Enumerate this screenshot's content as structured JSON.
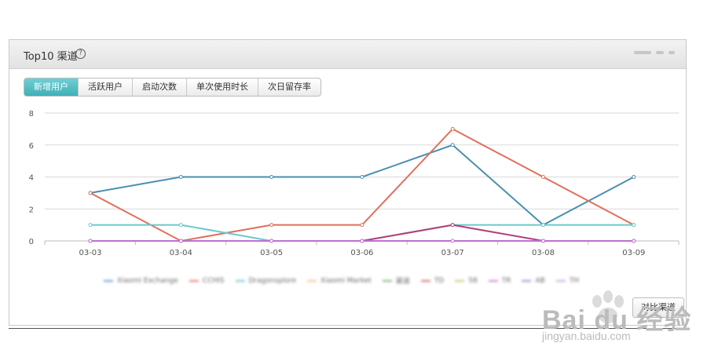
{
  "panel": {
    "title": "Top10 渠道",
    "help": "?",
    "tabs": [
      "新增用户",
      "活跃用户",
      "启动次数",
      "单次使用时长",
      "次日留存率"
    ],
    "active_tab": 0,
    "compare_button": "对比渠道"
  },
  "legend_items": [
    {
      "name": "Xiaomi Exchange",
      "color": "#5b9bd5"
    },
    {
      "name": "CCHIS",
      "color": "#e07a5f"
    },
    {
      "name": "Dragonsplore",
      "color": "#6cc9cc"
    },
    {
      "name": "Xiaomi Market",
      "color": "#f2c28b"
    },
    {
      "name": "渠道",
      "color": "#7bb07b"
    },
    {
      "name": "TD",
      "color": "#d06a6a"
    },
    {
      "name": "58",
      "color": "#c9c46a"
    },
    {
      "name": "TR",
      "color": "#d37bc6"
    },
    {
      "name": "AB",
      "color": "#9c88d4"
    },
    {
      "name": "TH",
      "color": "#c9a6d9"
    }
  ],
  "chart_data": {
    "type": "line",
    "categories": [
      "03-03",
      "03-04",
      "03-05",
      "03-06",
      "03-07",
      "03-08",
      "03-09"
    ],
    "ylim": [
      0,
      8
    ],
    "yticks": [
      0,
      2,
      4,
      6,
      8
    ],
    "grid": true,
    "series": [
      {
        "color": "#4a8fb0",
        "values": [
          3,
          4,
          4,
          4,
          6,
          1,
          4
        ]
      },
      {
        "color": "#e0705a",
        "values": [
          3,
          0,
          1,
          1,
          7,
          4,
          1
        ]
      },
      {
        "color": "#6cc9cc",
        "values": [
          1,
          1,
          0,
          0,
          1,
          1,
          1
        ]
      },
      {
        "color": "#b0407a",
        "values": [
          0,
          0,
          0,
          0,
          1,
          0,
          0
        ]
      },
      {
        "color": "#c070d0",
        "values": [
          0,
          0,
          0,
          0,
          0,
          0,
          0
        ]
      }
    ]
  },
  "watermark": {
    "main": "Bai du 经验",
    "sub": "jingyan.baidu.com"
  }
}
